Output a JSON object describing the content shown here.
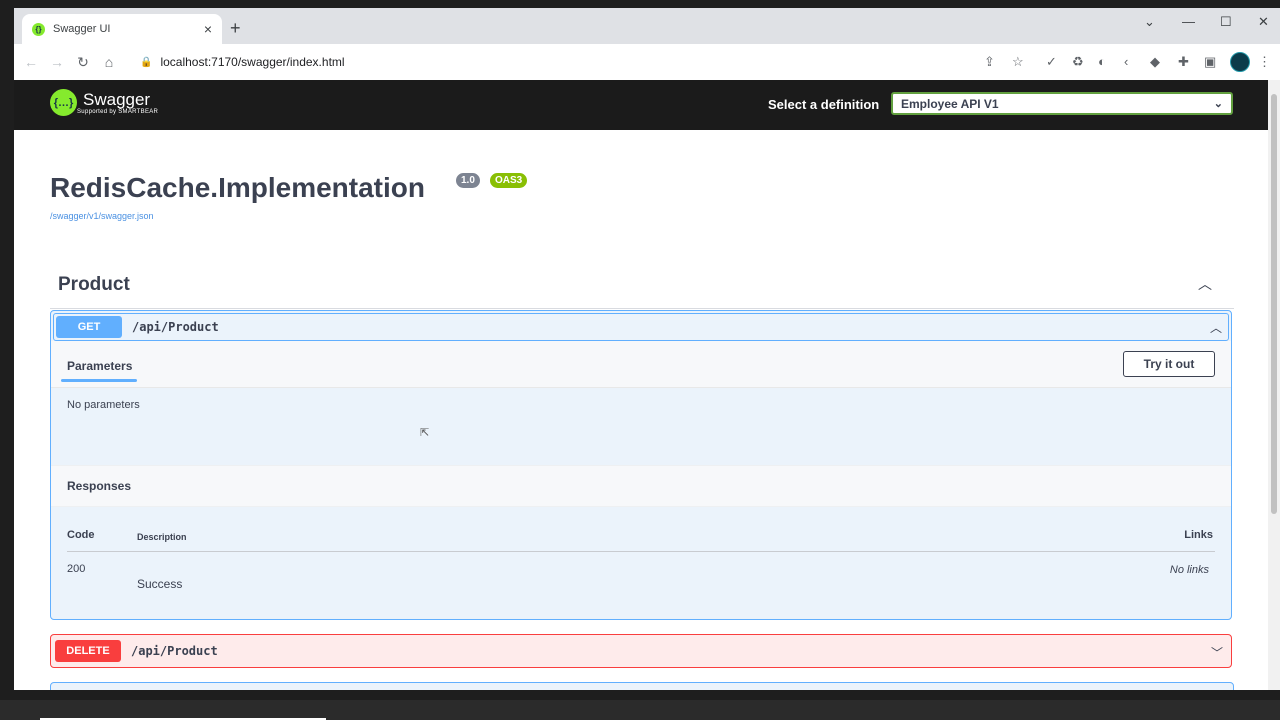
{
  "browser": {
    "tab_title": "Swagger UI",
    "tab_close": "×",
    "new_tab": "+",
    "url": "localhost:7170/swagger/index.html"
  },
  "topbar": {
    "logo_text": "Swagger",
    "logo_sub": "Supported by SMARTBEAR",
    "definition_label": "Select a definition",
    "definition_value": "Employee API V1"
  },
  "info": {
    "title": "RedisCache.Implementation",
    "version": "1.0",
    "oas": "OAS3",
    "spec_url": "/swagger/v1/swagger.json"
  },
  "tag": {
    "name": "Product"
  },
  "op_get": {
    "method": "GET",
    "path": "/api/Product",
    "parameters_tab": "Parameters",
    "try_button": "Try it out",
    "no_parameters": "No parameters",
    "responses_title": "Responses",
    "col_code": "Code",
    "col_description": "Description",
    "col_links": "Links",
    "rows": [
      {
        "code": "200",
        "description": "Success",
        "links": "No links"
      }
    ]
  },
  "op_delete": {
    "method": "DELETE",
    "path": "/api/Product"
  },
  "colors": {
    "get": "#61affe",
    "delete": "#f93e3e",
    "swagger_green": "#85ea2d",
    "topbar": "#1b1b1b"
  }
}
